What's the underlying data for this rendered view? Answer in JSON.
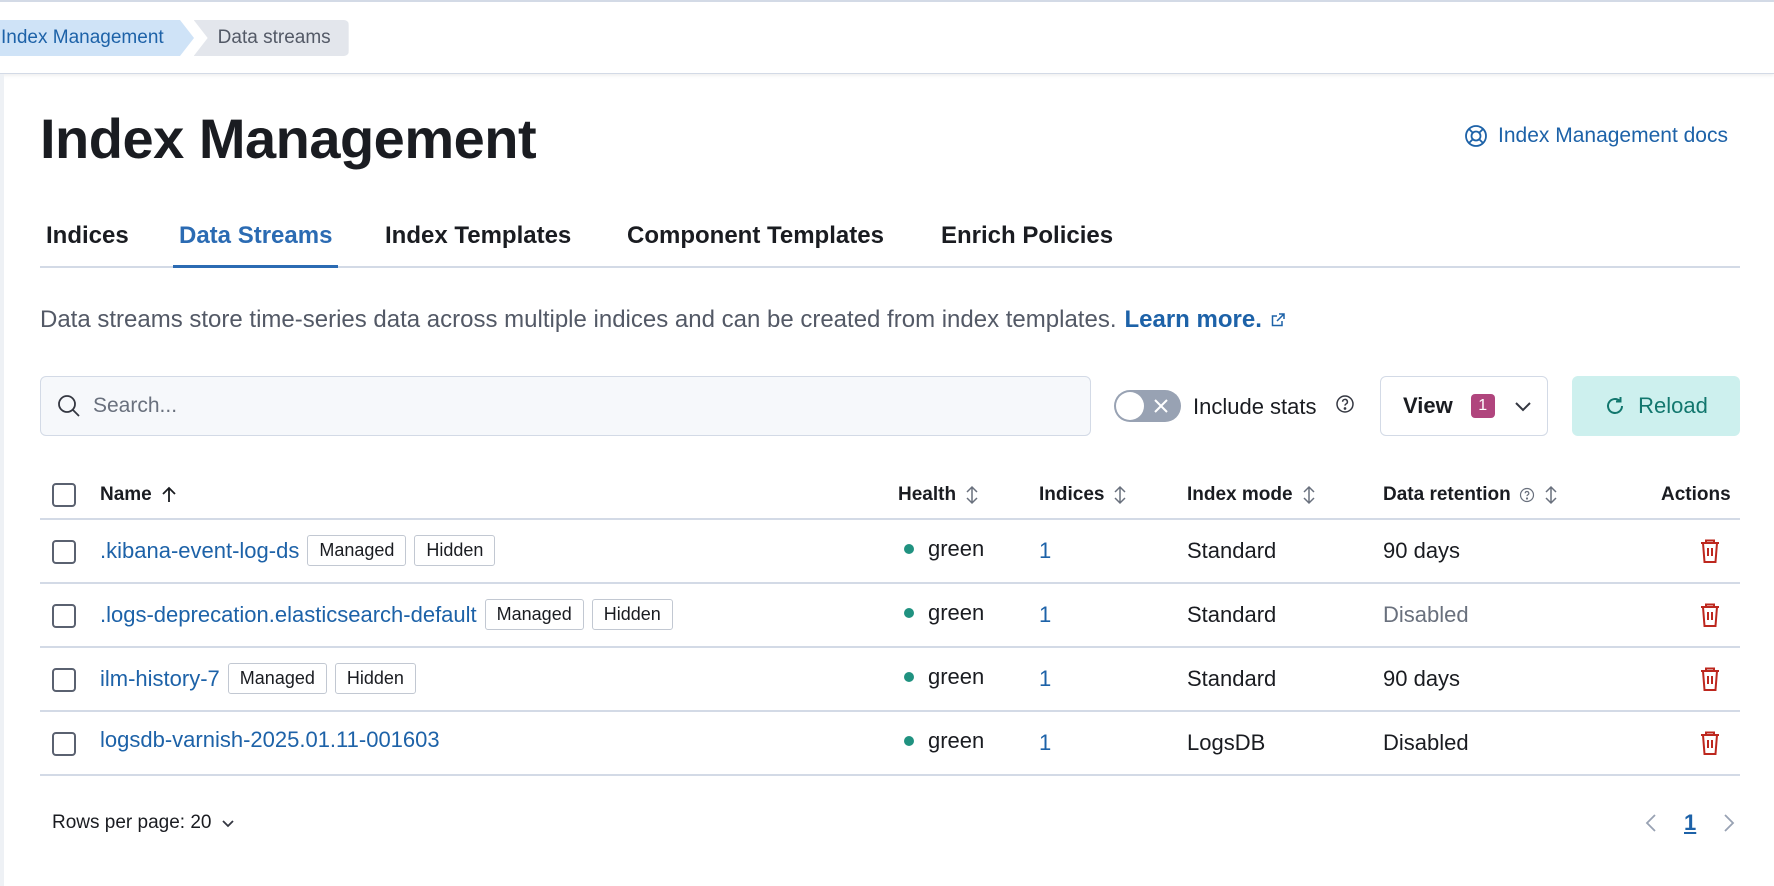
{
  "breadcrumbs": [
    "Index Management",
    "Data streams"
  ],
  "page": {
    "title": "Index Management",
    "docs_link": "Index Management docs"
  },
  "tabs": [
    "Indices",
    "Data Streams",
    "Index Templates",
    "Component Templates",
    "Enrich Policies"
  ],
  "active_tab": "Data Streams",
  "description": {
    "text": "Data streams store time-series data across multiple indices and can be created from index templates.",
    "link": "Learn more."
  },
  "search": {
    "placeholder": "Search...",
    "value": ""
  },
  "toggle": {
    "label": "Include stats",
    "on": false
  },
  "view_button": {
    "label": "View",
    "badge": "1"
  },
  "reload_button": {
    "label": "Reload"
  },
  "columns": {
    "name": "Name",
    "health": "Health",
    "indices": "Indices",
    "index_mode": "Index mode",
    "data_retention": "Data retention",
    "actions": "Actions"
  },
  "rows": [
    {
      "name": ".kibana-event-log-ds",
      "tags": [
        "Managed",
        "Hidden"
      ],
      "health": "green",
      "indices": "1",
      "index_mode": "Standard",
      "data_retention": "90 days"
    },
    {
      "name": ".logs-deprecation.elasticsearch-default",
      "tags": [
        "Managed",
        "Hidden"
      ],
      "health": "green",
      "indices": "1",
      "index_mode": "Standard",
      "data_retention": "Disabled"
    },
    {
      "name": "ilm-history-7",
      "tags": [
        "Managed",
        "Hidden"
      ],
      "health": "green",
      "indices": "1",
      "index_mode": "Standard",
      "data_retention": "90 days"
    },
    {
      "name": "logsdb-varnish-2025.01.11-001603",
      "tags": [],
      "health": "green",
      "indices": "1",
      "index_mode": "LogsDB",
      "data_retention": "Disabled"
    }
  ],
  "footer": {
    "rows_per_page": "Rows per page: 20"
  },
  "pagination": {
    "current_page": "1"
  },
  "colors": {
    "link": "#1d62a8",
    "health_green": "#209280",
    "delete": "#bd271e",
    "reload_bg": "#cdf0ee"
  }
}
